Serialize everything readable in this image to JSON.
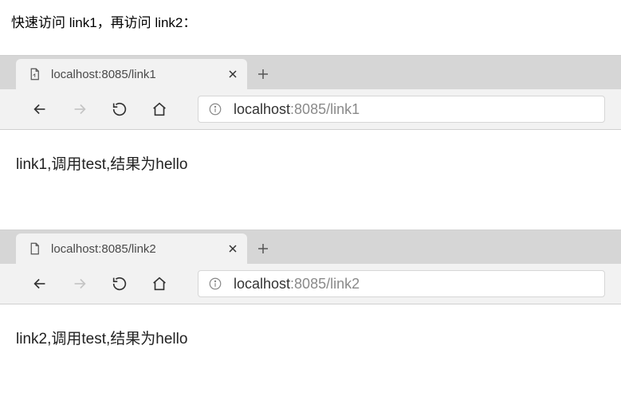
{
  "intro": "快速访问 link1，再访问 link2：",
  "browser1": {
    "tab_title": "localhost:8085/link1",
    "url_host": "localhost",
    "url_rest": ":8085/link1",
    "page_body": "link1,调用test,结果为hello"
  },
  "browser2": {
    "tab_title": "localhost:8085/link2",
    "url_host": "localhost",
    "url_rest": ":8085/link2",
    "page_body": "link2,调用test,结果为hello"
  }
}
